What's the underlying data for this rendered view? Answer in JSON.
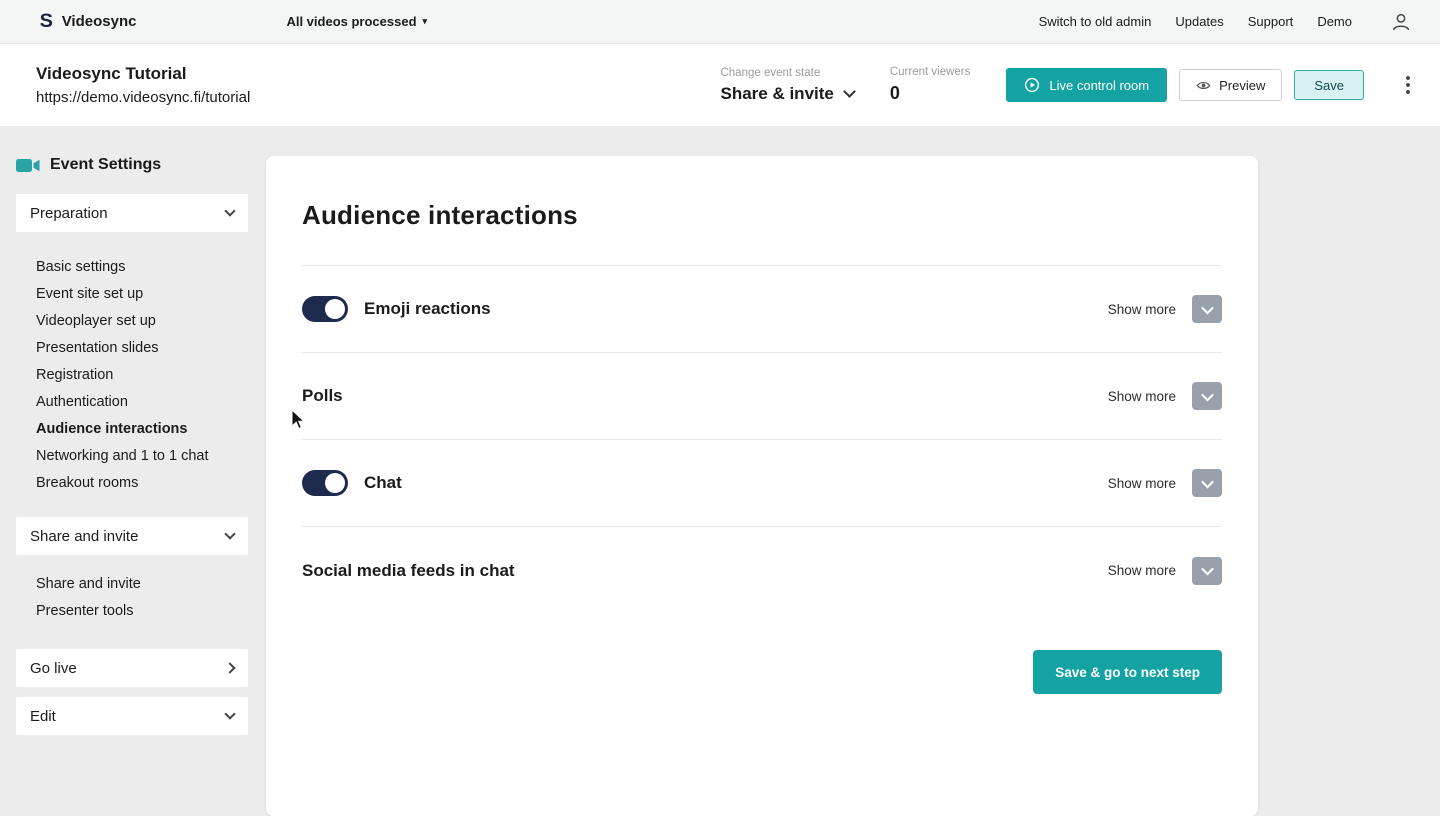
{
  "topbar": {
    "brand": "Videosync",
    "videos_status": "All videos processed",
    "links": [
      "Switch to old admin",
      "Updates",
      "Support",
      "Demo"
    ]
  },
  "header": {
    "title": "Videosync Tutorial",
    "url": "https://demo.videosync.fi/tutorial",
    "event_state_label": "Change event state",
    "event_state_value": "Share & invite",
    "viewers_label": "Current viewers",
    "viewers_count": "0",
    "live_button": "Live control room",
    "preview_button": "Preview",
    "save_button": "Save"
  },
  "sidebar": {
    "heading": "Event Settings",
    "sections": [
      {
        "label": "Preparation",
        "items": [
          "Basic settings",
          "Event site set up",
          "Videoplayer set up",
          "Presentation slides",
          "Registration",
          "Authentication",
          "Audience interactions",
          "Networking and 1 to 1 chat",
          "Breakout rooms"
        ],
        "active_item": "Audience interactions"
      },
      {
        "label": "Share and invite",
        "items": [
          "Share and invite",
          "Presenter tools"
        ]
      },
      {
        "label": "Go live",
        "items": []
      },
      {
        "label": "Edit",
        "items": []
      }
    ]
  },
  "main": {
    "title": "Audience interactions",
    "rows": [
      {
        "label": "Emoji reactions",
        "toggle": true,
        "show_more": "Show more"
      },
      {
        "label": "Polls",
        "toggle": null,
        "show_more": "Show more"
      },
      {
        "label": "Chat",
        "toggle": true,
        "show_more": "Show more"
      },
      {
        "label": "Social media feeds in chat",
        "toggle": null,
        "show_more": "Show more"
      }
    ],
    "save_next_button": "Save & go to next step"
  },
  "colors": {
    "accent": "#14a2a2",
    "toggle_on": "#1e2a4e",
    "show_more_button": "#98a1ab"
  }
}
